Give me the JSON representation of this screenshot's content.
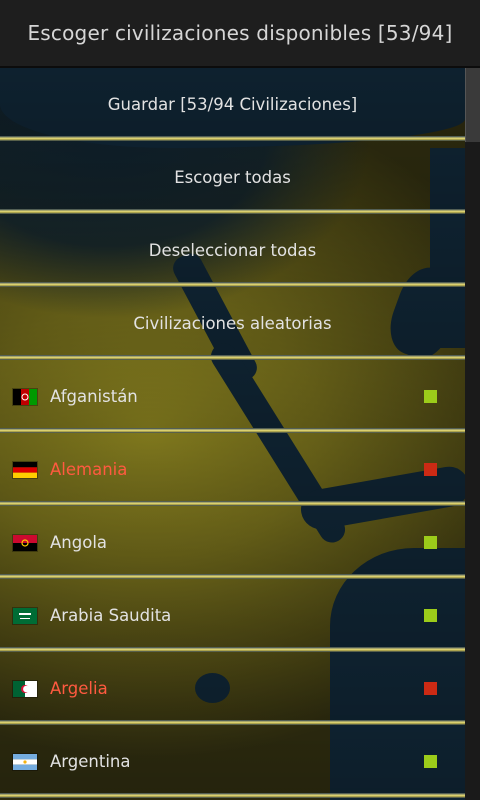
{
  "header": {
    "title": "Escoger civilizaciones disponibles [53/94]"
  },
  "actions": [
    {
      "label": "Guardar [53/94 Civilizaciones]"
    },
    {
      "label": "Escoger todas"
    },
    {
      "label": "Deseleccionar todas"
    },
    {
      "label": "Civilizaciones aleatorias"
    }
  ],
  "civilizations": [
    {
      "name": "Afganistán",
      "selected": true,
      "flag": "afghanistan-flag-icon"
    },
    {
      "name": "Alemania",
      "selected": false,
      "flag": "germany-flag-icon"
    },
    {
      "name": "Angola",
      "selected": true,
      "flag": "angola-flag-icon"
    },
    {
      "name": "Arabia Saudita",
      "selected": true,
      "flag": "saudi-arabia-flag-icon"
    },
    {
      "name": "Argelia",
      "selected": false,
      "flag": "algeria-flag-icon"
    },
    {
      "name": "Argentina",
      "selected": true,
      "flag": "argentina-flag-icon"
    }
  ],
  "colors": {
    "selected": "#9ccc1a",
    "deselected": "#cc2a14",
    "deselected_text": "#ff5a40"
  }
}
